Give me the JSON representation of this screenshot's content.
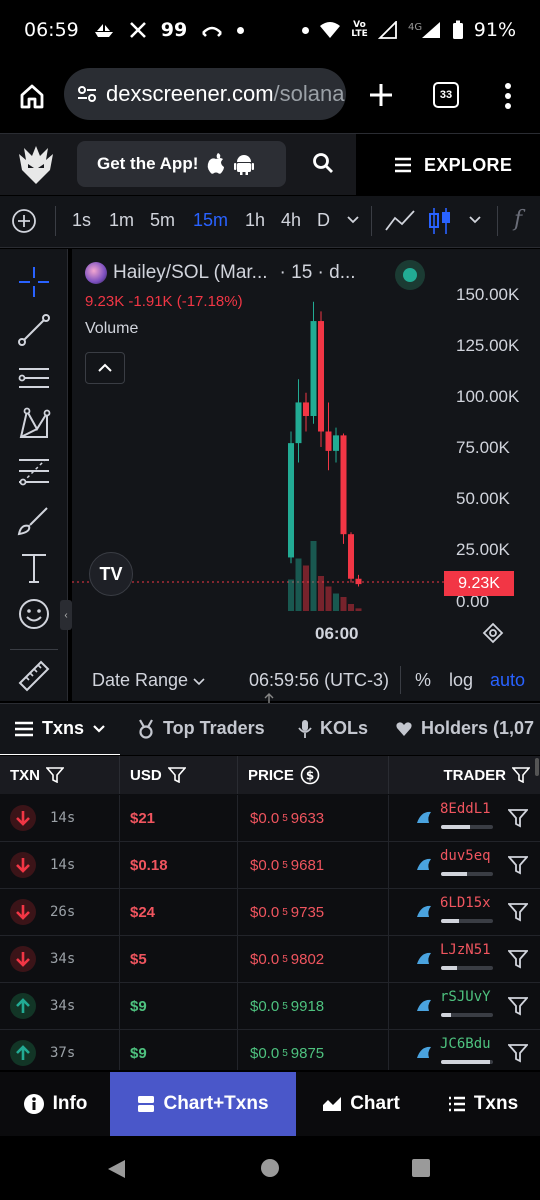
{
  "status_bar": {
    "time": "06:59",
    "notif_count": "99",
    "battery": "91%",
    "network": "4G"
  },
  "browser": {
    "url_host": "dexscreener.com",
    "url_path": "/solana",
    "tab_count": "33"
  },
  "header": {
    "get_app_label": "Get the App!",
    "explore_label": "EXPLORE"
  },
  "chart_toolbar": {
    "timeframes": [
      "1s",
      "1m",
      "5m",
      "15m",
      "1h",
      "4h",
      "D"
    ],
    "active_timeframe": "15m"
  },
  "chart": {
    "symbol_title": "Hailey/SOL (Mar...",
    "interval_suffix": "· 15 · d...",
    "price_change": "9.23K  -1.91K (-17.18%)",
    "volume_label": "Volume",
    "y_labels": [
      "150.00K",
      "125.00K",
      "100.00K",
      "75.00K",
      "50.00K",
      "25.00K",
      "0.00"
    ],
    "last_price_label": "9.23K",
    "time_label": "06:00",
    "footer": {
      "date_range": "Date Range",
      "clock": "06:59:56 (UTC-3)",
      "percent": "%",
      "log": "log",
      "auto": "auto"
    },
    "colors": {
      "up": "#22ab94",
      "down": "#f23645",
      "active": "#2962ff"
    }
  },
  "chart_data": {
    "type": "candlestick",
    "ylim": [
      0,
      160000
    ],
    "candles": [
      {
        "open": 23000,
        "close": 82000,
        "high": 88000,
        "low": 20000,
        "volume": 18000,
        "dir": "up"
      },
      {
        "open": 82000,
        "close": 103000,
        "high": 115000,
        "low": 72000,
        "volume": 30000,
        "dir": "up"
      },
      {
        "open": 103000,
        "close": 96000,
        "high": 108000,
        "low": 88000,
        "volume": 26000,
        "dir": "down"
      },
      {
        "open": 96000,
        "close": 145000,
        "high": 155000,
        "low": 92000,
        "volume": 40000,
        "dir": "up"
      },
      {
        "open": 145000,
        "close": 88000,
        "high": 150000,
        "low": 80000,
        "volume": 20000,
        "dir": "down"
      },
      {
        "open": 88000,
        "close": 78000,
        "high": 103000,
        "low": 68000,
        "volume": 14000,
        "dir": "down"
      },
      {
        "open": 78000,
        "close": 86000,
        "high": 90000,
        "low": 72000,
        "volume": 10000,
        "dir": "up"
      },
      {
        "open": 86000,
        "close": 35000,
        "high": 87000,
        "low": 30000,
        "volume": 8000,
        "dir": "down"
      },
      {
        "open": 35000,
        "close": 12000,
        "high": 36000,
        "low": 10000,
        "volume": 4000,
        "dir": "down"
      },
      {
        "open": 12000,
        "close": 9230,
        "high": 14000,
        "low": 8000,
        "volume": 1500,
        "dir": "down"
      }
    ]
  },
  "tabs": [
    {
      "label": "Txns",
      "active": true
    },
    {
      "label": "Top Traders"
    },
    {
      "label": "KOLs"
    },
    {
      "label": "Holders (1,07"
    }
  ],
  "table": {
    "headers": {
      "txn": "TXN",
      "usd": "USD",
      "price": "PRICE",
      "trader": "TRADER"
    },
    "rows": [
      {
        "type": "sell",
        "age": "14s",
        "usd": "$21",
        "price_prefix": "$0.0",
        "price_sub": "5",
        "price_digits": "9633",
        "trader": "8EddL1",
        "bar": 0.55
      },
      {
        "type": "sell",
        "age": "14s",
        "usd": "$0.18",
        "price_prefix": "$0.0",
        "price_sub": "5",
        "price_digits": "9681",
        "trader": "duv5eq",
        "bar": 0.5
      },
      {
        "type": "sell",
        "age": "26s",
        "usd": "$24",
        "price_prefix": "$0.0",
        "price_sub": "5",
        "price_digits": "9735",
        "trader": "6LD15x",
        "bar": 0.35
      },
      {
        "type": "sell",
        "age": "34s",
        "usd": "$5",
        "price_prefix": "$0.0",
        "price_sub": "5",
        "price_digits": "9802",
        "trader": "LJzN51",
        "bar": 0.3
      },
      {
        "type": "buy",
        "age": "34s",
        "usd": "$9",
        "price_prefix": "$0.0",
        "price_sub": "5",
        "price_digits": "9918",
        "trader": "rSJUvY",
        "bar": 0.2
      },
      {
        "type": "buy",
        "age": "37s",
        "usd": "$9",
        "price_prefix": "$0.0",
        "price_sub": "5",
        "price_digits": "9875",
        "trader": "JC6Bdu",
        "bar": 0.95
      }
    ]
  },
  "bottom_nav": {
    "info": "Info",
    "chart_txns": "Chart+Txns",
    "chart": "Chart",
    "txns": "Txns"
  }
}
